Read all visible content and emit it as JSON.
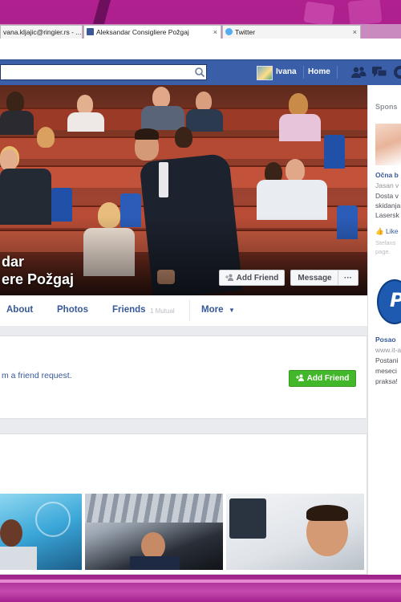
{
  "browser": {
    "tabs": [
      {
        "label": "vana.kljajic@ringier.rs - ...",
        "icon": "mail-icon",
        "color": "#4a8bd4"
      },
      {
        "label": "Aleksandar Consigliere Požgaj",
        "icon": "facebook-icon",
        "color": "#3b5998"
      },
      {
        "label": "Twitter",
        "icon": "twitter-icon",
        "color": "#55acee"
      }
    ],
    "close_glyph": "×"
  },
  "topbar": {
    "user_name": "Ivana",
    "home_label": "Home",
    "icons": [
      "friend-requests-icon",
      "messages-icon",
      "notifications-icon"
    ]
  },
  "profile": {
    "name_line1": "dar",
    "name_line2": "ere Požgaj",
    "add_friend_label": "Add Friend",
    "message_label": "Message",
    "more_dots": "···"
  },
  "profile_nav": {
    "about": "About",
    "photos": "Photos",
    "friends": "Friends",
    "mutual": "1 Mutual",
    "more": "More",
    "caret": "▼"
  },
  "friend_request": {
    "text": "m a friend request.",
    "button": "Add Friend"
  },
  "sidebar": {
    "sponsored": "Spons",
    "ad1_title": "Očna b",
    "ad1_source": "Jasan v",
    "ad1_line1": "Dosta v",
    "ad1_line2": "skidanja",
    "ad1_line3": "Lasersk",
    "ad1_like": "Like",
    "ad1_like_by": "Stefans",
    "ad1_like_by2": "page.",
    "ad2_title": "Posao",
    "ad2_source": "www.it-a",
    "ad2_line1": "Postani",
    "ad2_line2": "meseci",
    "ad2_line3": "praksa!"
  },
  "colors": {
    "facebook_blue": "#3a5fa8",
    "link_blue": "#365899",
    "friend_green": "#42b72a",
    "frame_magenta": "#b0208f"
  }
}
